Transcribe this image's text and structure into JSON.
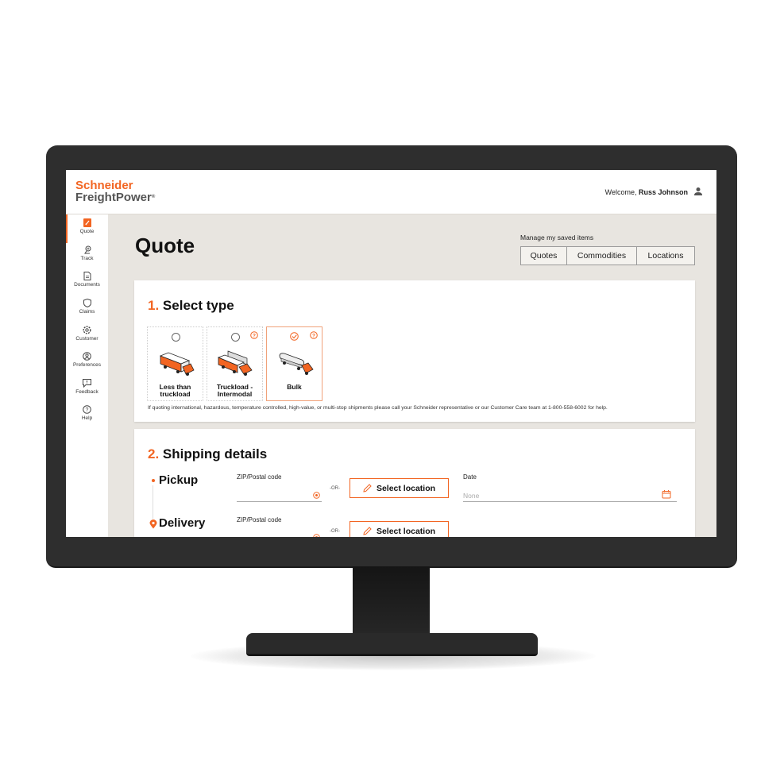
{
  "header": {
    "logo_line1": "Schneider",
    "logo_line2": "FreightPower",
    "logo_mark": "®",
    "welcome_prefix": "Welcome, ",
    "user_name": "Russ Johnson",
    "user_icon": "person-icon"
  },
  "sidebar": {
    "items": [
      {
        "label": "Quote",
        "icon": "quote-icon",
        "active": true
      },
      {
        "label": "Track",
        "icon": "track-icon",
        "active": false
      },
      {
        "label": "Documents",
        "icon": "documents-icon",
        "active": false
      },
      {
        "label": "Claims",
        "icon": "shield-icon",
        "active": false
      },
      {
        "label": "Customer",
        "icon": "gear-icon",
        "active": false
      },
      {
        "label": "Preferences",
        "icon": "profile-icon",
        "active": false
      },
      {
        "label": "Feedback",
        "icon": "feedback-icon",
        "active": false
      },
      {
        "label": "Help",
        "icon": "help-icon",
        "active": false
      }
    ]
  },
  "main": {
    "title": "Quote",
    "saved": {
      "label": "Manage my saved items",
      "buttons": [
        "Quotes",
        "Commodities",
        "Locations"
      ]
    },
    "select_type": {
      "number": "1.",
      "title": "Select type",
      "options": [
        {
          "label_line1": "Less than",
          "label_line2": "truckload",
          "selected": false,
          "has_help": false
        },
        {
          "label_line1": "Truckload -",
          "label_line2": "Intermodal",
          "selected": false,
          "has_help": true
        },
        {
          "label_line1": "Bulk",
          "label_line2": "",
          "selected": true,
          "has_help": true
        }
      ],
      "note": "If quoting international, hazardous, temperature controlled, high-value, or multi-stop shipments please call your Schneider representative or our Customer Care team at 1-800-558-6002 for help."
    },
    "shipping": {
      "number": "2.",
      "title": "Shipping details",
      "pickup": {
        "label": "Pickup",
        "zip_label": "ZIP/Postal code",
        "zip_value": "",
        "or": "-OR-",
        "select_button": "Select location",
        "date_label": "Date",
        "date_placeholder": "None"
      },
      "delivery": {
        "label": "Delivery",
        "zip_label": "ZIP/Postal code",
        "zip_value": "",
        "or": "-OR-",
        "select_button": "Select location"
      }
    }
  },
  "colors": {
    "accent": "#f26522",
    "page_bg": "#e8e5e0",
    "monitor": "#2e2e2e"
  }
}
